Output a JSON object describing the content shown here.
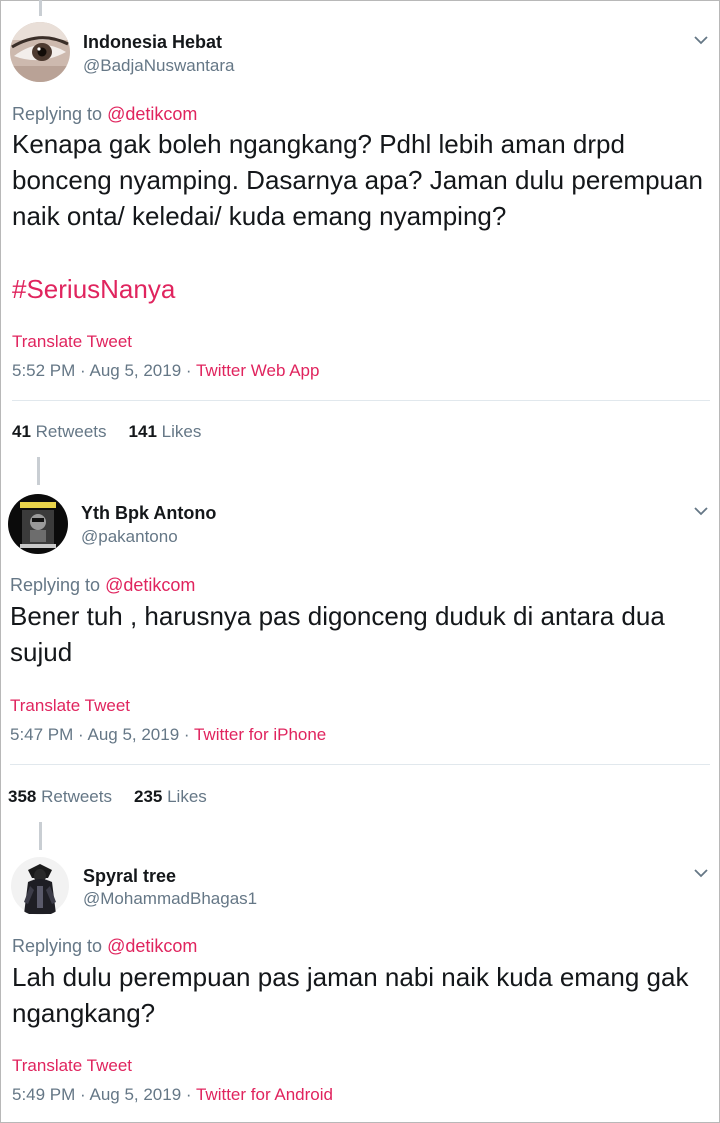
{
  "tweets": [
    {
      "name": "Indonesia Hebat",
      "handle": "@BadjaNuswantara",
      "replying_label": "Replying to",
      "replying_to": "@detikcom",
      "text": "Kenapa gak boleh ngangkang? Pdhl lebih aman drpd bonceng nyamping. Dasarnya apa? Jaman dulu perempuan naik onta/ keledai/ kuda emang nyamping?",
      "hashtag": "#SeriusNanya",
      "translate": "Translate Tweet",
      "time": "5:52 PM · Aug 5, 2019 · ",
      "source": "Twitter Web App",
      "retweets": "41",
      "retweets_label": "Retweets",
      "likes": "141",
      "likes_label": "Likes"
    },
    {
      "name": "Yth Bpk Antono",
      "handle": "@pakantono",
      "replying_label": "Replying to",
      "replying_to": "@detikcom",
      "text": "Bener tuh , harusnya pas digonceng duduk di antara dua sujud",
      "translate": "Translate Tweet",
      "time": "5:47 PM · Aug 5, 2019 · ",
      "source": "Twitter for iPhone",
      "retweets": "358",
      "retweets_label": "Retweets",
      "likes": "235",
      "likes_label": "Likes"
    },
    {
      "name": "Spyral tree",
      "handle": "@MohammadBhagas1",
      "replying_label": "Replying to",
      "replying_to": "@detikcom",
      "text": "Lah dulu perempuan pas jaman nabi naik kuda emang gak ngangkang?",
      "translate": "Translate Tweet",
      "time": "5:49 PM · Aug 5, 2019 · ",
      "source": "Twitter for Android"
    }
  ],
  "icons": {
    "chevron": "chevron-down-icon",
    "avatar": "avatar-image"
  },
  "colors": {
    "accent": "#e0245e",
    "muted": "#657786",
    "text": "#14171a"
  }
}
